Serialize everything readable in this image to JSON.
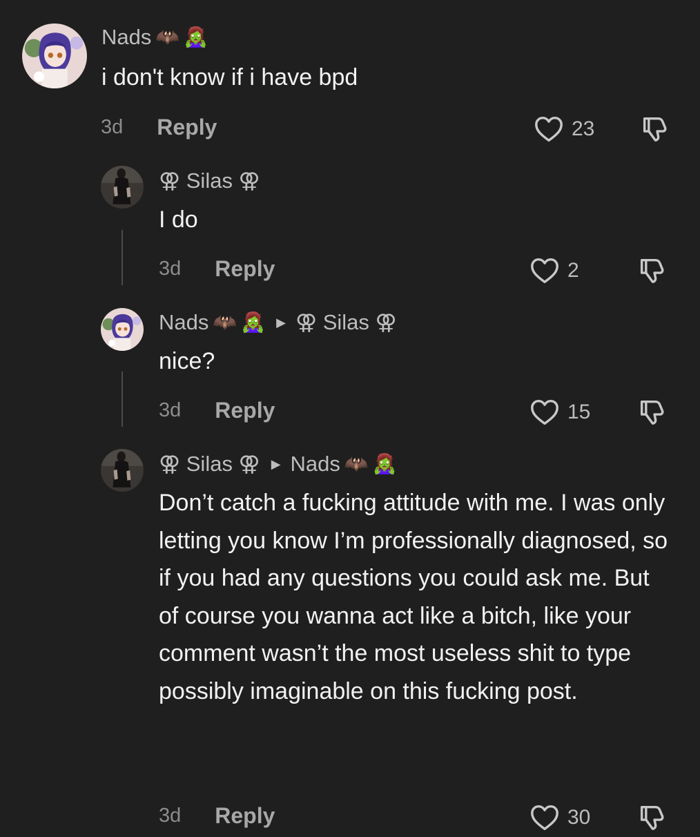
{
  "comments": [
    {
      "username": "Nads",
      "badges": [
        "🦇",
        "🧟‍♀️"
      ],
      "text": "i don't know if i have bpd",
      "time": "3d",
      "reply_label": "Reply",
      "likes": "23"
    },
    {
      "username": "⚢ Silas ⚢",
      "text": "I do",
      "time": "3d",
      "reply_label": "Reply",
      "likes": "2"
    },
    {
      "username": "Nads",
      "badges": [
        "🦇",
        "🧟‍♀️"
      ],
      "reply_to": "⚢ Silas ⚢",
      "text": "nice?",
      "time": "3d",
      "reply_label": "Reply",
      "likes": "15"
    },
    {
      "username": "⚢ Silas ⚢",
      "reply_to": "Nads",
      "reply_to_badges": [
        "🦇",
        "🧟‍♀️"
      ],
      "text": "Don’t catch a fucking attitude with me. I was only letting you know I’m professionally diagnosed, so if you had any questions you could ask me. But of course you wanna act like a bitch, like your comment wasn’t the most useless shit to type possibly imaginable on this fucking post.",
      "time": "3d",
      "reply_label": "Reply",
      "likes": "30"
    }
  ],
  "icons": {
    "like": "heart-icon",
    "dislike": "thumbs-down-icon",
    "reply_arrow": "caret-right-icon"
  },
  "colors": {
    "background": "#1f1f1f",
    "username": "#bdbdbd",
    "text": "#f2f2f2",
    "muted": "#8d8d8d"
  }
}
